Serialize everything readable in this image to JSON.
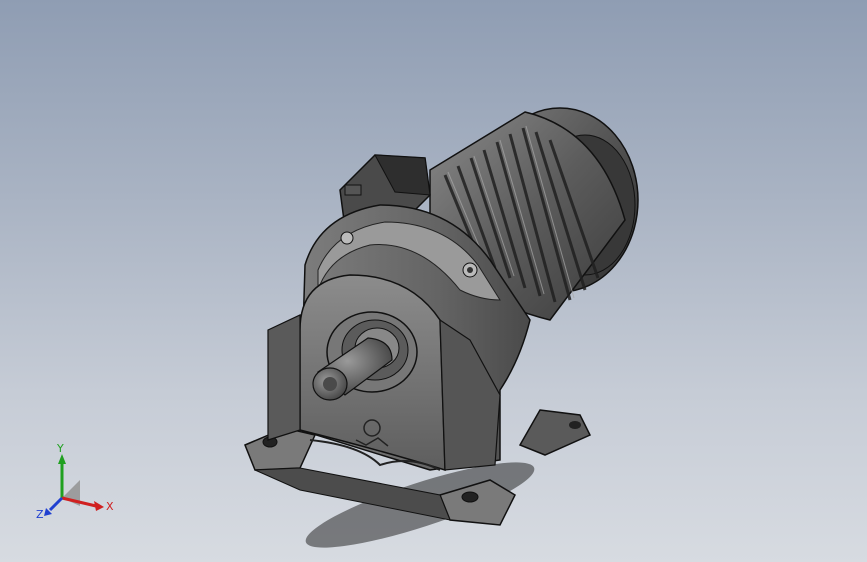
{
  "viewport": {
    "background_top": "#8f9db3",
    "background_bottom": "#d7dbe1"
  },
  "model": {
    "icon": "gear-motor-3d-model",
    "body_color": "#6e6e6e",
    "shade_color": "#3a3a3a",
    "highlight_color": "#bdbdbd"
  },
  "triad": {
    "x_label": "X",
    "y_label": "Y",
    "z_label": "Z",
    "x_color": "#d02020",
    "y_color": "#20a020",
    "z_color": "#2040d0"
  }
}
